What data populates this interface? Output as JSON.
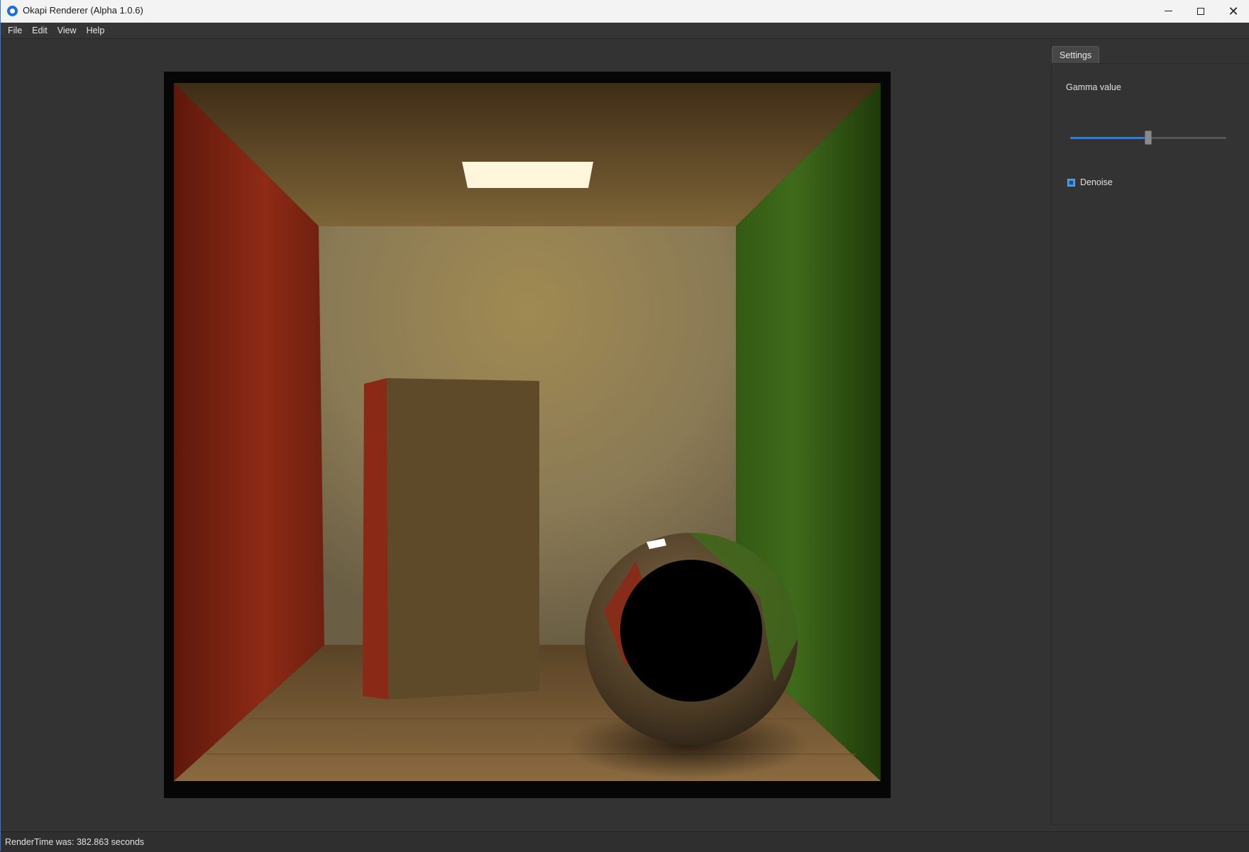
{
  "window": {
    "title": "Okapi Renderer (Alpha 1.0.6)",
    "minimize_label": "minimize",
    "maximize_label": "maximize",
    "close_label": "close"
  },
  "menu": {
    "items": [
      {
        "label": "File"
      },
      {
        "label": "Edit"
      },
      {
        "label": "View"
      },
      {
        "label": "Help"
      }
    ]
  },
  "settings": {
    "tab_label": "Settings",
    "gamma_label": "Gamma value",
    "gamma_fraction": 0.5,
    "denoise_label": "Denoise",
    "denoise_checked": true
  },
  "status": {
    "text": "RenderTime was: 382.863 seconds"
  },
  "colors": {
    "accent": "#2f7fd6",
    "left_wall": "#8a2614",
    "right_wall": "#3f6a1a",
    "back_wall": "#9c8a5c"
  }
}
